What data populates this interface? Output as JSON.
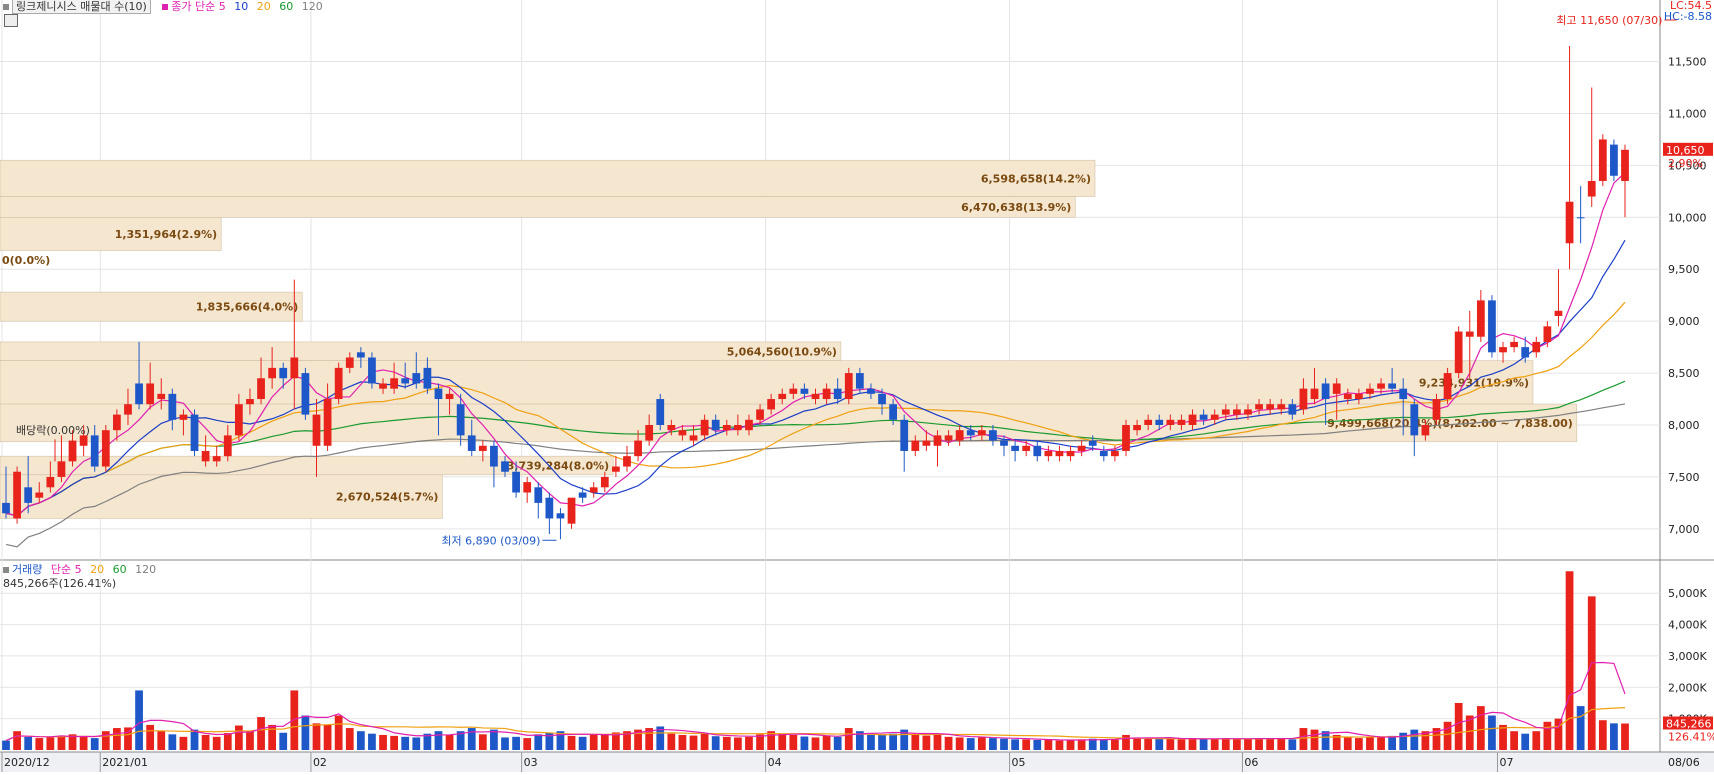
{
  "header": {
    "title": "링크제니시스 매물대 수(10)",
    "ma_prefix": "종가 단순 5",
    "ma_10": "10",
    "ma_20": "20",
    "ma_60": "60",
    "ma_120": "120"
  },
  "volume_header": {
    "label": "거래량",
    "ma_prefix": "단순 5",
    "ma_20": "20",
    "ma_60": "60",
    "ma_120": "120",
    "current": "845,266주(126.41%)"
  },
  "corner": {
    "lc": "LC:54.5",
    "hc": "HC:-8.58"
  },
  "price_tag": {
    "price": "10,650",
    "pct": "2.90%"
  },
  "volume_tag": {
    "value": "845,266",
    "pct": "126.41%"
  },
  "price_axis_labels": [
    "11,500",
    "11,000",
    "10,500",
    "10,000",
    "9,500",
    "9,000",
    "8,500",
    "8,000",
    "7,500",
    "7,000"
  ],
  "volume_axis_labels": [
    "5,000K",
    "4,000K",
    "3,000K",
    "2,000K",
    "1,000K"
  ],
  "x_axis_labels": [
    "2020/12",
    "2021/01",
    "02",
    "03",
    "04",
    "05",
    "06",
    "07",
    "08",
    "08/06"
  ],
  "annotations": {
    "high": "최고 11,650 (07/30)",
    "low": "최저 6,890 (03/09)",
    "dividend": "배당락(0.00%)"
  },
  "colors": {
    "up": "#e8231c",
    "down": "#1e58c8",
    "ma5": "#e020b0",
    "ma10": "#1a3ec8",
    "ma20": "#f0a010",
    "ma60": "#1a9a30",
    "ma120": "#808080",
    "profile": "#f5e6d0",
    "profile_text": "#7a4a10"
  },
  "chart_data": {
    "type": "candlestick",
    "title": "링크제니시스 매물대 수(10)",
    "price_range": [
      6700,
      11900
    ],
    "volume_range_k": [
      0,
      5900
    ],
    "price_ticks": [
      7000,
      7500,
      8000,
      8500,
      9000,
      9500,
      10000,
      10500,
      11000,
      11500
    ],
    "volume_ticks_k": [
      1000,
      2000,
      3000,
      4000,
      5000
    ],
    "candles": [
      [
        7250,
        7600,
        7150,
        7100,
        false,
        300
      ],
      [
        7550,
        7600,
        7100,
        7050,
        true,
        600
      ],
      [
        7250,
        7700,
        7400,
        7150,
        false,
        420
      ],
      [
        7300,
        7450,
        7350,
        7250,
        true,
        380
      ],
      [
        7400,
        7650,
        7500,
        7350,
        true,
        400
      ],
      [
        7500,
        7900,
        7650,
        7450,
        true,
        450
      ],
      [
        7650,
        7950,
        7850,
        7600,
        true,
        500
      ],
      [
        7800,
        8000,
        7900,
        7700,
        true,
        420
      ],
      [
        7900,
        8000,
        7600,
        7550,
        false,
        380
      ],
      [
        7600,
        8000,
        7950,
        7550,
        true,
        600
      ],
      [
        7950,
        8150,
        8100,
        7850,
        true,
        700
      ],
      [
        8100,
        8350,
        8200,
        8000,
        true,
        720
      ],
      [
        8200,
        8800,
        8400,
        8150,
        false,
        1900
      ],
      [
        8400,
        8600,
        8200,
        8150,
        true,
        800
      ],
      [
        8250,
        8450,
        8300,
        8150,
        true,
        600
      ],
      [
        8300,
        8350,
        8050,
        7950,
        false,
        500
      ],
      [
        8050,
        8150,
        8100,
        7900,
        true,
        420
      ],
      [
        8100,
        8150,
        7750,
        7700,
        false,
        650
      ],
      [
        7750,
        7900,
        7650,
        7600,
        true,
        480
      ],
      [
        7650,
        7800,
        7700,
        7600,
        true,
        420
      ],
      [
        7700,
        8000,
        7900,
        7650,
        true,
        540
      ],
      [
        7900,
        8300,
        8200,
        7850,
        true,
        780
      ],
      [
        8200,
        8350,
        8250,
        8100,
        true,
        600
      ],
      [
        8250,
        8650,
        8450,
        8200,
        true,
        1050
      ],
      [
        8450,
        8750,
        8550,
        8350,
        true,
        800
      ],
      [
        8550,
        8600,
        8450,
        8350,
        false,
        550
      ],
      [
        8450,
        9400,
        8650,
        8150,
        true,
        1900
      ],
      [
        8500,
        8550,
        8100,
        8050,
        false,
        1100
      ],
      [
        8100,
        8250,
        7800,
        7500,
        true,
        850
      ],
      [
        7800,
        8400,
        8250,
        7750,
        true,
        800
      ],
      [
        8250,
        8600,
        8550,
        8200,
        true,
        1100
      ],
      [
        8550,
        8700,
        8650,
        8500,
        true,
        700
      ],
      [
        8650,
        8750,
        8700,
        8550,
        false,
        600
      ],
      [
        8650,
        8700,
        8400,
        8350,
        false,
        520
      ],
      [
        8400,
        8450,
        8350,
        8300,
        true,
        480
      ],
      [
        8350,
        8600,
        8450,
        8300,
        true,
        450
      ],
      [
        8450,
        8600,
        8400,
        8350,
        false,
        420
      ],
      [
        8400,
        8700,
        8500,
        8350,
        false,
        400
      ],
      [
        8550,
        8650,
        8350,
        8300,
        false,
        520
      ],
      [
        8350,
        8400,
        8250,
        7900,
        false,
        600
      ],
      [
        8250,
        8350,
        8300,
        8100,
        true,
        480
      ],
      [
        8200,
        8300,
        7900,
        7800,
        false,
        600
      ],
      [
        7900,
        8050,
        7750,
        7700,
        false,
        700
      ],
      [
        7750,
        7850,
        7800,
        7650,
        true,
        500
      ],
      [
        7800,
        7850,
        7600,
        7400,
        false,
        650
      ],
      [
        7650,
        7700,
        7550,
        7500,
        false,
        400
      ],
      [
        7550,
        7650,
        7350,
        7300,
        false,
        420
      ],
      [
        7350,
        7500,
        7450,
        7250,
        true,
        380
      ],
      [
        7400,
        7450,
        7250,
        7100,
        false,
        500
      ],
      [
        7300,
        7350,
        7100,
        6950,
        false,
        550
      ],
      [
        7150,
        7200,
        7100,
        6900,
        false,
        600
      ],
      [
        7050,
        7200,
        7300,
        7000,
        true,
        450
      ],
      [
        7300,
        7400,
        7350,
        7250,
        false,
        420
      ],
      [
        7350,
        7450,
        7400,
        7300,
        true,
        480
      ],
      [
        7400,
        7550,
        7500,
        7350,
        true,
        500
      ],
      [
        7550,
        7700,
        7600,
        7500,
        true,
        560
      ],
      [
        7600,
        7800,
        7700,
        7550,
        true,
        600
      ],
      [
        7700,
        7950,
        7850,
        7650,
        true,
        650
      ],
      [
        7850,
        8100,
        8000,
        7800,
        true,
        700
      ],
      [
        8000,
        8300,
        8250,
        7950,
        false,
        750
      ],
      [
        8000,
        8050,
        7950,
        7900,
        true,
        520
      ],
      [
        7950,
        8000,
        7900,
        7850,
        true,
        480
      ],
      [
        7900,
        8000,
        7850,
        7800,
        true,
        460
      ],
      [
        7900,
        8100,
        8050,
        7850,
        true,
        520
      ],
      [
        8050,
        8100,
        7950,
        7900,
        false,
        440
      ],
      [
        7950,
        8050,
        8000,
        7900,
        true,
        420
      ],
      [
        8000,
        8100,
        7950,
        7900,
        true,
        400
      ],
      [
        7950,
        8100,
        8050,
        7900,
        true,
        420
      ],
      [
        8050,
        8200,
        8150,
        8000,
        true,
        500
      ],
      [
        8150,
        8300,
        8250,
        8100,
        true,
        600
      ],
      [
        8250,
        8350,
        8300,
        8200,
        true,
        520
      ],
      [
        8300,
        8400,
        8350,
        8250,
        true,
        480
      ],
      [
        8350,
        8400,
        8300,
        8250,
        false,
        430
      ],
      [
        8300,
        8350,
        8250,
        8200,
        true,
        400
      ],
      [
        8250,
        8400,
        8350,
        8200,
        true,
        450
      ],
      [
        8350,
        8450,
        8250,
        8200,
        false,
        420
      ],
      [
        8250,
        8550,
        8500,
        8200,
        true,
        700
      ],
      [
        8500,
        8550,
        8350,
        8300,
        false,
        600
      ],
      [
        8350,
        8400,
        8300,
        8250,
        false,
        480
      ],
      [
        8300,
        8350,
        8200,
        8100,
        false,
        500
      ],
      [
        8200,
        8250,
        8050,
        8000,
        false,
        520
      ],
      [
        8050,
        8100,
        7750,
        7550,
        false,
        650
      ],
      [
        7750,
        7900,
        7850,
        7700,
        true,
        500
      ],
      [
        7850,
        7950,
        7800,
        7750,
        true,
        460
      ],
      [
        7800,
        7950,
        7900,
        7600,
        true,
        480
      ],
      [
        7900,
        7950,
        7850,
        7800,
        true,
        420
      ],
      [
        7850,
        8000,
        7950,
        7800,
        true,
        400
      ],
      [
        7950,
        8000,
        7900,
        7850,
        false,
        380
      ],
      [
        7900,
        8000,
        7950,
        7850,
        true,
        400
      ],
      [
        7950,
        8000,
        7850,
        7800,
        false,
        380
      ],
      [
        7850,
        7900,
        7800,
        7700,
        false,
        360
      ],
      [
        7800,
        7850,
        7750,
        7650,
        false,
        340
      ],
      [
        7750,
        7850,
        7800,
        7700,
        true,
        340
      ],
      [
        7800,
        7850,
        7700,
        7650,
        false,
        320
      ],
      [
        7700,
        7800,
        7750,
        7650,
        true,
        320
      ],
      [
        7750,
        7800,
        7700,
        7650,
        true,
        300
      ],
      [
        7700,
        7800,
        7750,
        7650,
        true,
        320
      ],
      [
        7750,
        7850,
        7800,
        7700,
        true,
        340
      ],
      [
        7800,
        7900,
        7850,
        7750,
        false,
        360
      ],
      [
        7750,
        7800,
        7700,
        7650,
        false,
        340
      ],
      [
        7700,
        7800,
        7750,
        7650,
        true,
        330
      ],
      [
        7750,
        8050,
        8000,
        7700,
        true,
        480
      ],
      [
        7950,
        8050,
        8000,
        7900,
        true,
        400
      ],
      [
        8000,
        8100,
        8050,
        7950,
        true,
        380
      ],
      [
        8050,
        8100,
        8000,
        7950,
        false,
        350
      ],
      [
        8000,
        8100,
        8050,
        7950,
        true,
        360
      ],
      [
        8050,
        8100,
        8000,
        7950,
        true,
        340
      ],
      [
        8000,
        8150,
        8100,
        7950,
        true,
        380
      ],
      [
        8100,
        8150,
        8050,
        8000,
        false,
        340
      ],
      [
        8050,
        8150,
        8100,
        8000,
        true,
        360
      ],
      [
        8100,
        8200,
        8150,
        8050,
        true,
        380
      ],
      [
        8150,
        8200,
        8100,
        8050,
        true,
        340
      ],
      [
        8100,
        8200,
        8150,
        8050,
        true,
        360
      ],
      [
        8150,
        8250,
        8200,
        8100,
        true,
        380
      ],
      [
        8200,
        8250,
        8150,
        8100,
        true,
        360
      ],
      [
        8150,
        8250,
        8200,
        8100,
        true,
        380
      ],
      [
        8200,
        8250,
        8100,
        8050,
        false,
        340
      ],
      [
        8150,
        8450,
        8350,
        8100,
        true,
        700
      ],
      [
        8350,
        8550,
        8250,
        8200,
        true,
        650
      ],
      [
        8250,
        8450,
        8400,
        8000,
        false,
        600
      ],
      [
        8400,
        8450,
        8300,
        8050,
        true,
        480
      ],
      [
        8300,
        8350,
        8250,
        8200,
        true,
        400
      ],
      [
        8250,
        8350,
        8300,
        8200,
        true,
        380
      ],
      [
        8300,
        8400,
        8350,
        8250,
        true,
        400
      ],
      [
        8350,
        8450,
        8400,
        8300,
        true,
        420
      ],
      [
        8400,
        8550,
        8350,
        8300,
        false,
        450
      ],
      [
        8350,
        8450,
        8250,
        7900,
        false,
        550
      ],
      [
        8200,
        8250,
        7900,
        7700,
        false,
        650
      ],
      [
        7900,
        8050,
        8000,
        7850,
        true,
        600
      ],
      [
        8050,
        8300,
        8250,
        8000,
        true,
        700
      ],
      [
        8250,
        8550,
        8500,
        8200,
        true,
        900
      ],
      [
        8500,
        8950,
        8900,
        8450,
        true,
        1500
      ],
      [
        8900,
        9100,
        8850,
        8450,
        true,
        1100
      ],
      [
        8850,
        9300,
        9200,
        8800,
        true,
        1400
      ],
      [
        9200,
        9250,
        8700,
        8650,
        false,
        1100
      ],
      [
        8700,
        8800,
        8750,
        8600,
        true,
        800
      ],
      [
        8750,
        8850,
        8800,
        8700,
        true,
        600
      ],
      [
        8750,
        8850,
        8650,
        8600,
        false,
        520
      ],
      [
        8700,
        8850,
        8800,
        8650,
        true,
        600
      ],
      [
        8800,
        9000,
        8950,
        8750,
        true,
        900
      ],
      [
        9050,
        9500,
        9100,
        8950,
        true,
        1000
      ],
      [
        9750,
        11650,
        10150,
        9500,
        true,
        5700
      ],
      [
        10000,
        10300,
        10000,
        9750,
        false,
        1400
      ],
      [
        10200,
        11250,
        10350,
        10100,
        true,
        4900
      ],
      [
        10350,
        10800,
        10750,
        10300,
        true,
        950
      ],
      [
        10700,
        10750,
        10400,
        10350,
        false,
        850
      ],
      [
        10350,
        10700,
        10650,
        10000,
        true,
        845
      ]
    ],
    "overlay_ranges": [
      "2020/12",
      "08/06"
    ],
    "volume_profile": [
      {
        "label": "6,598,658(14.2%)",
        "price_lo": 10200,
        "price_hi": 10550,
        "len": 1000
      },
      {
        "label": "6,470,638(13.9%)",
        "price_lo": 10000,
        "price_hi": 10200,
        "len": 982
      },
      {
        "label": "1,351,964(2.9%)",
        "price_lo": 9680,
        "price_hi": 10000,
        "len": 202
      },
      {
        "label": "0(0.0%)",
        "price_lo": 9500,
        "price_hi": 9680,
        "len": 0
      },
      {
        "label": "1,835,666(4.0%)",
        "price_lo": 9000,
        "price_hi": 9280,
        "len": 276
      },
      {
        "label": "5,064,560(10.9%)",
        "price_lo": 8620,
        "price_hi": 8800,
        "len": 768
      },
      {
        "label": "9,234,931(19.9%)",
        "price_lo": 8200,
        "price_hi": 8620,
        "len": 1400
      },
      {
        "label": "9,499,668(20.4%)(8,202.00 ~ 7,838.00)",
        "price_lo": 7838,
        "price_hi": 8202,
        "len": 1440
      },
      {
        "label": "3,739,284(8.0%)",
        "price_lo": 7520,
        "price_hi": 7700,
        "len": 560
      },
      {
        "label": "2,670,524(5.7%)",
        "price_lo": 7100,
        "price_hi": 7520,
        "len": 404
      }
    ]
  }
}
